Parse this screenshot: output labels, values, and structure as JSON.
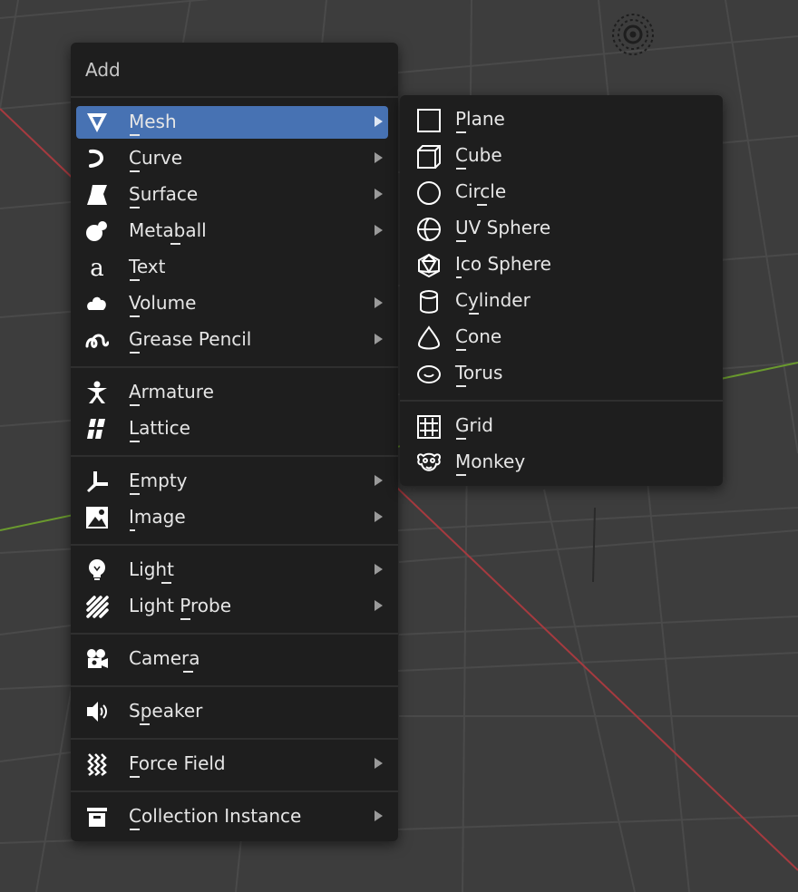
{
  "menu": {
    "title": "Add",
    "items": [
      {
        "label": "Mesh",
        "icon": "mesh-icon",
        "submenu": true,
        "active": true
      },
      {
        "label": "Curve",
        "icon": "curve-icon",
        "submenu": true
      },
      {
        "label": "Surface",
        "icon": "surface-icon",
        "submenu": true
      },
      {
        "label": "Metaball",
        "icon": "metaball-icon",
        "submenu": true
      },
      {
        "label": "Text",
        "icon": "text-icon",
        "submenu": false
      },
      {
        "label": "Volume",
        "icon": "volume-icon",
        "submenu": true
      },
      {
        "label": "Grease Pencil",
        "icon": "grease-pencil-icon",
        "submenu": true
      },
      {
        "label": "Armature",
        "icon": "armature-icon",
        "submenu": false
      },
      {
        "label": "Lattice",
        "icon": "lattice-icon",
        "submenu": false
      },
      {
        "label": "Empty",
        "icon": "empty-icon",
        "submenu": true
      },
      {
        "label": "Image",
        "icon": "image-icon",
        "submenu": true
      },
      {
        "label": "Light",
        "icon": "light-icon",
        "submenu": true
      },
      {
        "label": "Light Probe",
        "icon": "light-probe-icon",
        "submenu": true
      },
      {
        "label": "Camera",
        "icon": "camera-icon",
        "submenu": false
      },
      {
        "label": "Speaker",
        "icon": "speaker-icon",
        "submenu": false
      },
      {
        "label": "Force Field",
        "icon": "force-field-icon",
        "submenu": true
      },
      {
        "label": "Collection Instance",
        "icon": "collection-instance-icon",
        "submenu": true
      }
    ]
  },
  "mesh_submenu": {
    "items": [
      {
        "label": "Plane",
        "icon": "plane-icon"
      },
      {
        "label": "Cube",
        "icon": "cube-icon"
      },
      {
        "label": "Circle",
        "icon": "circle-icon"
      },
      {
        "label": "UV Sphere",
        "icon": "uv-sphere-icon"
      },
      {
        "label": "Ico Sphere",
        "icon": "ico-sphere-icon"
      },
      {
        "label": "Cylinder",
        "icon": "cylinder-icon"
      },
      {
        "label": "Cone",
        "icon": "cone-icon"
      },
      {
        "label": "Torus",
        "icon": "torus-icon"
      },
      {
        "label": "Grid",
        "icon": "grid-icon"
      },
      {
        "label": "Monkey",
        "icon": "monkey-icon"
      }
    ]
  },
  "colors": {
    "viewport_bg": "#3d3d3d",
    "menu_bg": "#1e1e1e",
    "highlight": "#4772b3",
    "text": "#e6e6e6",
    "x_axis": "#a63a3f",
    "y_axis": "#6a9a2e"
  }
}
